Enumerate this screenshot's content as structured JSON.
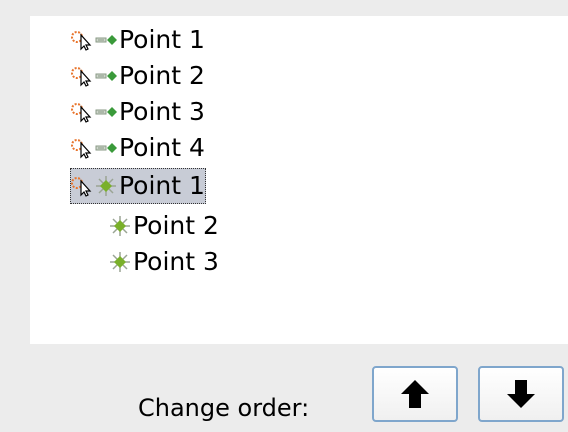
{
  "list": {
    "items": [
      {
        "label": "Point 1",
        "type": "waypoint",
        "selected": false
      },
      {
        "label": "Point 2",
        "type": "waypoint",
        "selected": false
      },
      {
        "label": "Point 3",
        "type": "waypoint",
        "selected": false
      },
      {
        "label": "Point 4",
        "type": "waypoint",
        "selected": false
      },
      {
        "label": "Point 1",
        "type": "star",
        "selected": true
      },
      {
        "label": "Point 2",
        "type": "star",
        "selected": false
      },
      {
        "label": "Point 3",
        "type": "star",
        "selected": false
      }
    ]
  },
  "footer": {
    "change_order_label": "Change order:",
    "move_up_icon": "arrow-up-icon",
    "move_down_icon": "arrow-down-icon"
  },
  "colors": {
    "selection": "#c8ccd6",
    "star_green": "#7ab02a",
    "orange": "#e8742c",
    "button_border": "#7fa6cc"
  }
}
